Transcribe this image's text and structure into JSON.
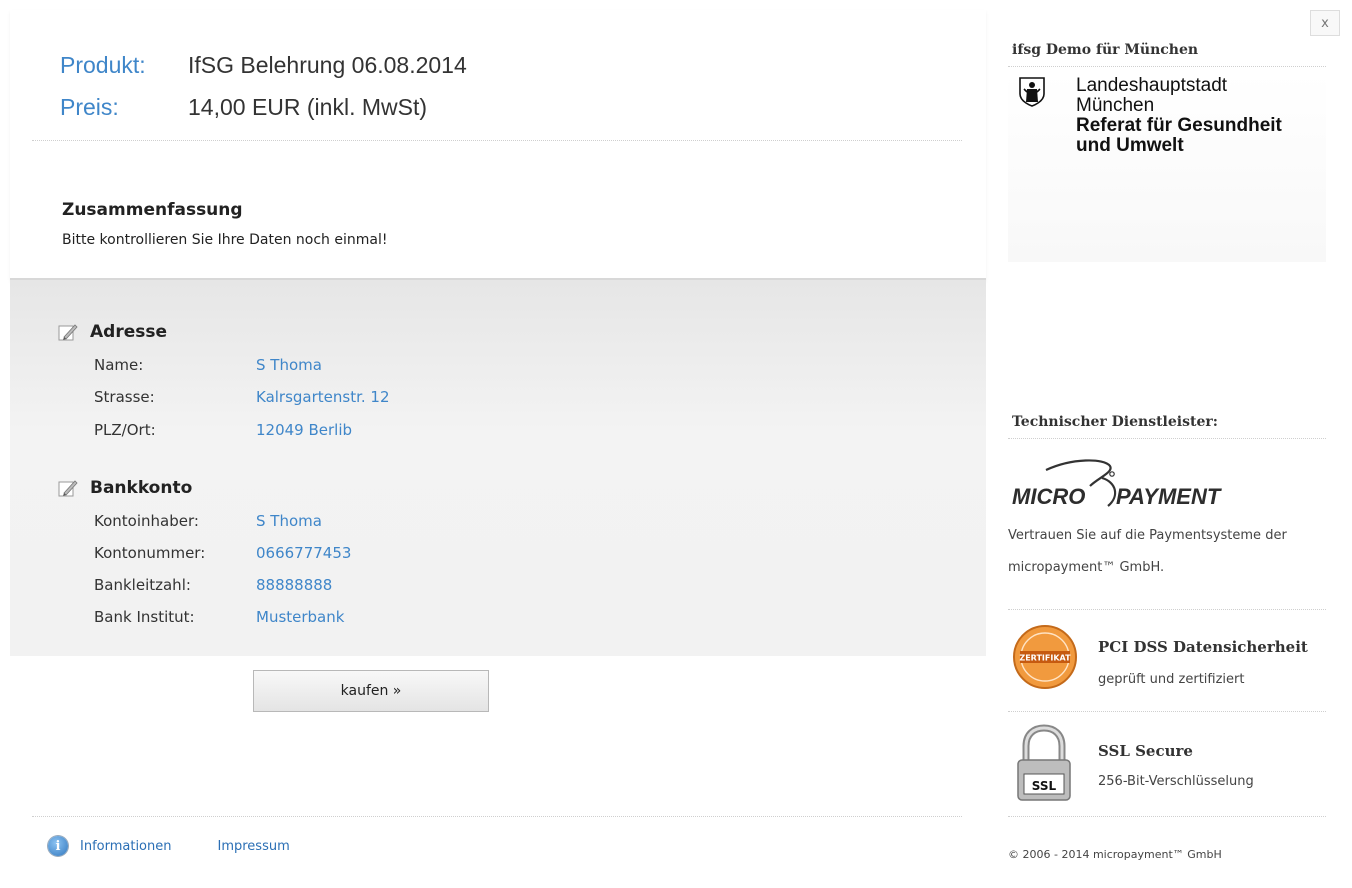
{
  "product": {
    "product_label": "Produkt:",
    "product_value": "IfSG Belehrung 06.08.2014",
    "price_label": "Preis:",
    "price_value": "14,00 EUR (inkl. MwSt)"
  },
  "summary": {
    "title": "Zusammenfassung",
    "text": "Bitte kontrollieren Sie Ihre Daten noch einmal!"
  },
  "address": {
    "heading": "Adresse",
    "rows": [
      {
        "label": "Name:",
        "value": "S Thoma"
      },
      {
        "label": "Strasse:",
        "value": "Kalrsgartenstr. 12"
      },
      {
        "label": "PLZ/Ort:",
        "value": "12049 Berlib"
      }
    ]
  },
  "bank": {
    "heading": "Bankkonto",
    "rows": [
      {
        "label": "Kontoinhaber:",
        "value": "S Thoma"
      },
      {
        "label": "Kontonummer:",
        "value": "0666777453"
      },
      {
        "label": "Bankleitzahl:",
        "value": "88888888"
      },
      {
        "label": "Bank Institut:",
        "value": "Musterbank"
      }
    ]
  },
  "buy_button": "kaufen »",
  "footer": {
    "info_icon_glyph": "i",
    "informationen": "Informationen",
    "impressum": "Impressum"
  },
  "close_label": "x",
  "sidebar": {
    "demo_heading": "ifsg Demo für München",
    "city_line1": "Landeshauptstadt",
    "city_line2": "München",
    "city_line3": "Referat für Gesundheit",
    "city_line4": "und Umwelt",
    "provider_heading": "Technischer Dienstleister:",
    "mp_logo_left": "MICRO",
    "mp_logo_right": "PAYMENT",
    "trust_line1": "Vertrauen Sie auf die Paymentsysteme der",
    "trust_line2": "micropayment™ GmbH.",
    "pci_seal": "ZERTIFIKAT",
    "pci_title": "PCI DSS Datensicherheit",
    "pci_text": "geprüft und zertifiziert",
    "ssl_badge": "SSL",
    "ssl_title": "SSL Secure",
    "ssl_text": "256-Bit-Verschlüsselung",
    "copyright": "© 2006 - 2014 micropayment™ GmbH"
  }
}
